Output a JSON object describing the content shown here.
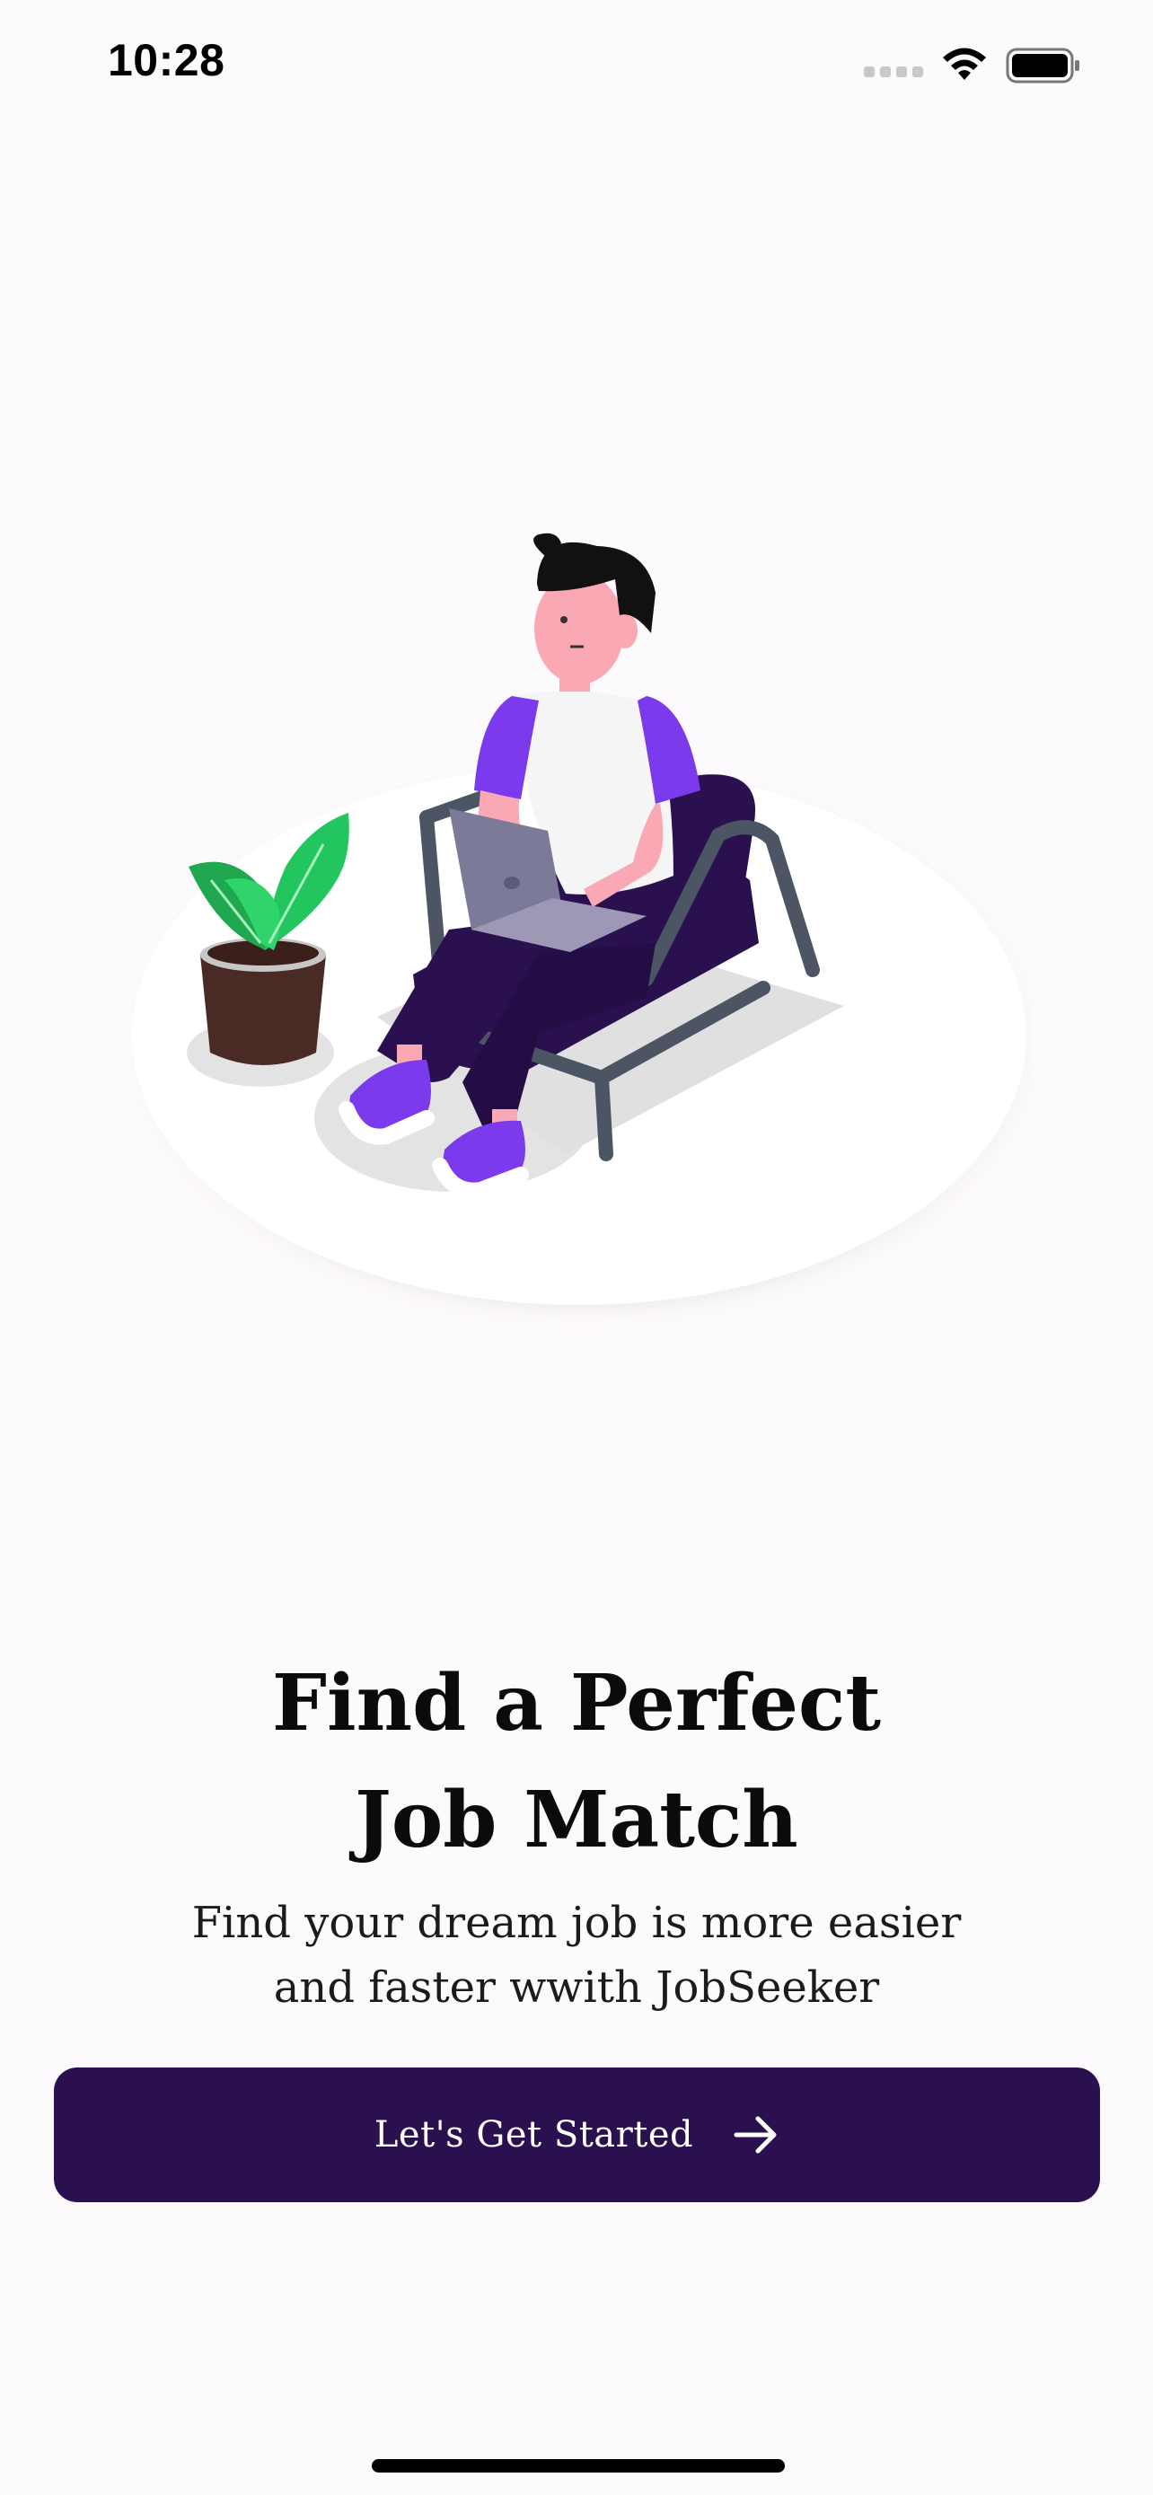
{
  "status_bar": {
    "time": "10:28",
    "signal_icon": "cellular-signal-icon",
    "wifi_icon": "wifi-icon",
    "battery_icon": "battery-icon"
  },
  "illustration": {
    "name": "person-with-laptop-illustration"
  },
  "onboarding": {
    "title_line1": "Find a Perfect",
    "title_line2": "Job Match",
    "subtitle_line1": "Find your dream job is more easier",
    "subtitle_line2": "and faster wwith JobSeeker",
    "cta_label": "Let's Get Started",
    "cta_icon": "arrow-right-icon"
  },
  "colors": {
    "background": "#fdfafd",
    "primary": "#2b1050",
    "accent_purple": "#7c3aed",
    "plant_green": "#22c55e"
  }
}
